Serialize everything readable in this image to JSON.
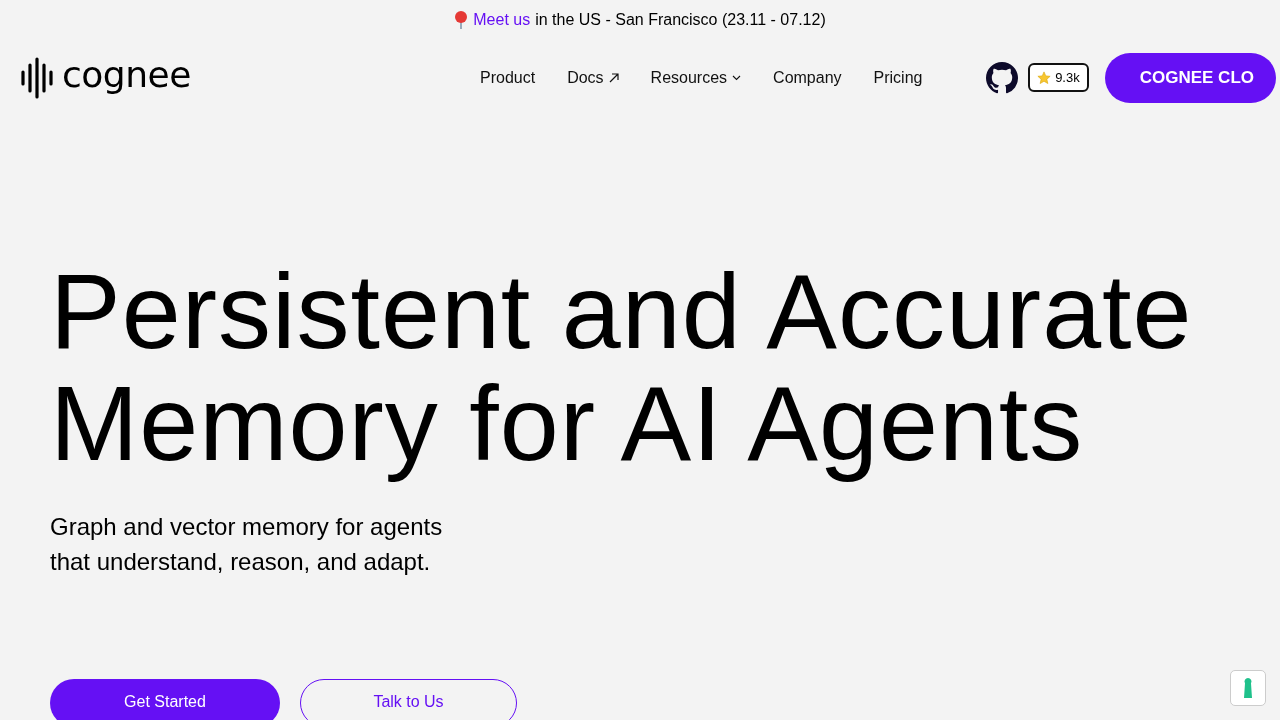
{
  "announcement": {
    "link": "Meet us",
    "text": "in the US - San Francisco (23.11 - 07.12)"
  },
  "header": {
    "logo": "cognee",
    "nav": [
      {
        "label": "Product",
        "kind": "plain"
      },
      {
        "label": "Docs",
        "kind": "external"
      },
      {
        "label": "Resources",
        "kind": "dropdown"
      },
      {
        "label": "Company",
        "kind": "plain"
      },
      {
        "label": "Pricing",
        "kind": "plain"
      }
    ],
    "stars": "9.3k",
    "cta": "COGNEE CLO"
  },
  "hero": {
    "title_lines": [
      "Persistent and Accurate",
      "Memory for AI Agents"
    ],
    "subtitle_lines": [
      "Graph and vector memory for agents",
      "that understand, reason, and adapt."
    ],
    "buttons": [
      {
        "label": "Get Started",
        "kind": "primary"
      },
      {
        "label": "Talk to Us",
        "kind": "outline"
      }
    ]
  }
}
